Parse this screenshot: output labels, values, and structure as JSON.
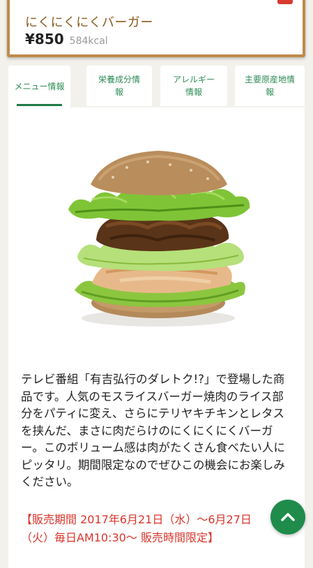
{
  "product": {
    "name": "にくにくにくバーガー",
    "price": "¥850",
    "calories": "584kcal"
  },
  "tabs": [
    {
      "label": "メニュー情報",
      "active": true
    },
    {
      "label": "栄養成分情\n報",
      "active": false
    },
    {
      "label": "アレルギー\n情報",
      "active": false
    },
    {
      "label": "主要原産地情\n報",
      "active": false
    }
  ],
  "description": "テレビ番組「有吉弘行のダレトク!?」で登場した商品です。人気のモスライスバーガー焼肉のライス部分をパティに変え、さらにテリヤキチキンとレタスを挟んだ、まさに肉だらけのにくにくにくバーガー。このボリューム感は肉がたくさん食べたい人にピッタリ。期間限定なのでぜひこの機会にお楽しみください。",
  "sale_notice": "【販売期間 2017年6月21日（水）〜6月27日（火）毎日AM10:30〜 販売時間限定】",
  "colors": {
    "accent_green": "#1f8c4b",
    "frame_wood": "#c08a4a",
    "notice_red": "#d9352b"
  },
  "icons": {
    "scroll_top": "chevron-up-icon"
  }
}
